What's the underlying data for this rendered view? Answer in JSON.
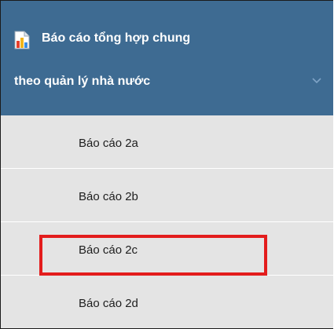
{
  "menu": {
    "header": {
      "icon": "report-chart-icon",
      "title_line1": "Báo cáo tổng hợp chung",
      "title_line2": "theo quản lý nhà nước",
      "expand_icon": "chevron-down-icon"
    },
    "items": [
      {
        "label": "Báo cáo 2a"
      },
      {
        "label": "Báo cáo 2b"
      },
      {
        "label": "Báo cáo 2c",
        "highlighted": true
      },
      {
        "label": "Báo cáo 2d"
      }
    ]
  },
  "colors": {
    "header_bg": "#3e6b92",
    "item_bg": "#e4e4e4",
    "highlight": "#e31c1c"
  }
}
